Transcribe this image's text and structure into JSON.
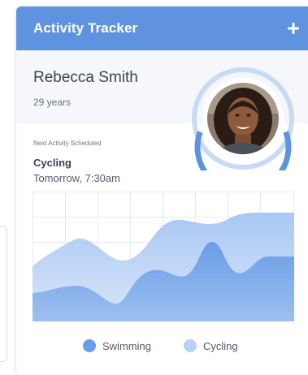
{
  "header": {
    "title": "Activity Tracker",
    "add_icon": "plus-icon"
  },
  "profile": {
    "name": "Rebecca Smith",
    "age": "29 years",
    "avatar": "avatar-photo"
  },
  "activity": {
    "label": "Next Activity Scheduled",
    "name": "Cycling",
    "time": "Tomorrow, 7:30am"
  },
  "colors": {
    "header": "#5f93e0",
    "swimming": "#6a9de6",
    "cycling": "#b9d2f5",
    "ring": "#5f93e0",
    "ring_light": "#c8daf5"
  },
  "chart_data": {
    "type": "area",
    "grid": true,
    "legend_position": "bottom",
    "series": [
      {
        "name": "Swimming"
      },
      {
        "name": "Cycling"
      }
    ]
  },
  "legend": [
    {
      "label": "Swimming",
      "color": "#6a9de6"
    },
    {
      "label": "Cycling",
      "color": "#b9d2f5"
    }
  ]
}
